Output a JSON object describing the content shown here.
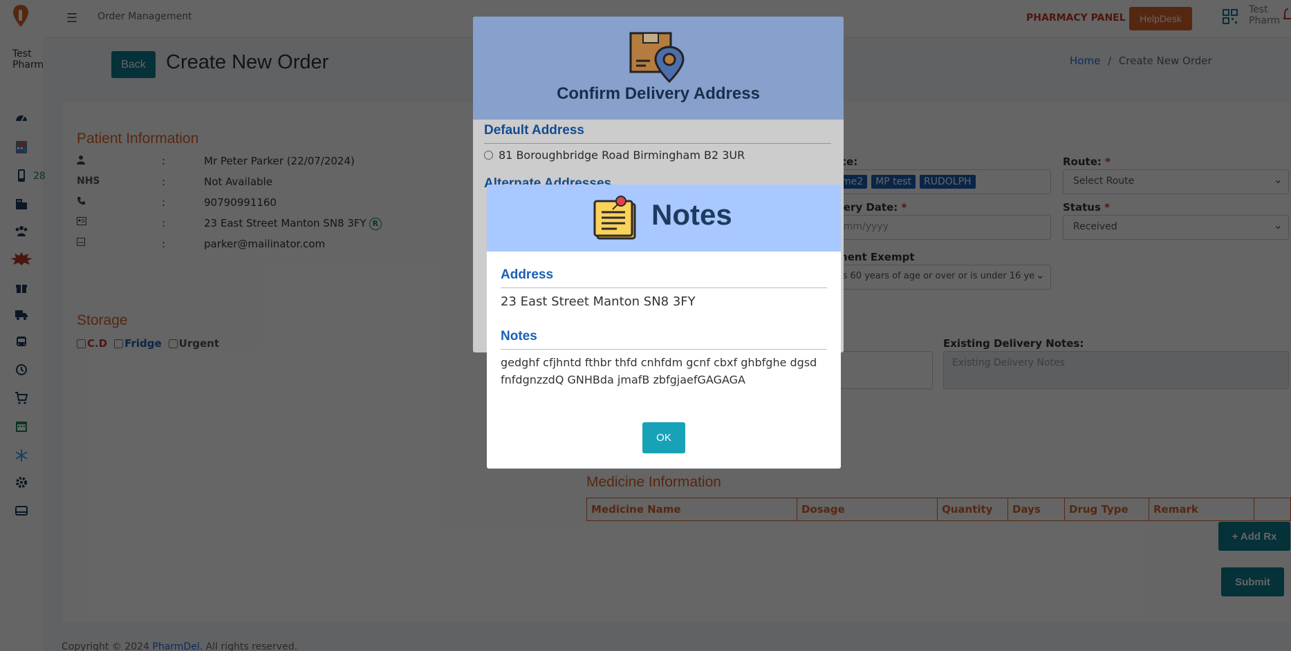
{
  "topbar": {
    "title": "Order Management",
    "panel_label": "PHARMACY PANEL",
    "helpdesk_label": "HelpDesk",
    "user_alt": "Test Pharm"
  },
  "sidebar": {
    "avatar_alt": "Test Pharm",
    "badge_count": "28",
    "icons": [
      "dashboard-icon",
      "calculator-icon",
      "mobile-icon",
      "building-icon",
      "users-icon",
      "promo-icon",
      "gift-icon",
      "truck-icon",
      "bus-icon",
      "history-icon",
      "cart-icon",
      "calendar-icon",
      "snowflake-icon",
      "gear-icon",
      "card-icon"
    ]
  },
  "page": {
    "back_label": "Back",
    "title": "Create New Order",
    "breadcrumb_home": "Home",
    "breadcrumb_sep": "/",
    "breadcrumb_current": "Create New Order"
  },
  "patient": {
    "section_title": "Patient Information",
    "colon": ":",
    "nhs_label": "NHS",
    "name": "Mr Peter Parker (22/07/2024)",
    "nhs": "Not Available",
    "phone": "90790991160",
    "address": "23 East Street Manton SN8 3FY",
    "address_badge": "R",
    "email": "parker@mailinator.com"
  },
  "storage": {
    "section_title": "Storage",
    "cd_label": "C.D",
    "fridge_label": "Fridge",
    "urgent_label": "Urgent"
  },
  "form": {
    "service_label": "ice:",
    "service_tags": [
      "me2",
      "MP test",
      "RUDOLPH"
    ],
    "route_label": "Route:",
    "route_placeholder": "Select Route",
    "delivery_date_label": "very Date:",
    "delivery_date_placeholder": "/mm/yyyy",
    "status_label": "Status",
    "status_value": "Received",
    "exempt_label": "ment Exempt",
    "exempt_value": "is 60 years of age or over or is under 16 ye",
    "existing_notes_label": "Existing Delivery Notes:",
    "existing_notes_placeholder": "Existing Delivery Notes",
    "required_mark": "*"
  },
  "medicine": {
    "section_title": "Medicine Information",
    "columns": [
      "Medicine Name",
      "Dosage",
      "Quantity",
      "Days",
      "Drug Type",
      "Remark",
      ""
    ],
    "add_rx_label": "+ Add Rx",
    "submit_label": "Submit"
  },
  "footer": {
    "text_before": "Copyright © 2024 ",
    "brand": "PharmDel",
    "text_after": ". All rights reserved."
  },
  "confirm_modal": {
    "title": "Confirm Delivery Address",
    "default_heading": "Default Address",
    "default_address": "81 Boroughbridge Road Birmingham B2 3UR",
    "alternate_heading": "Alternate Addresses"
  },
  "notes_modal": {
    "title": "Notes",
    "address_heading": "Address",
    "address": "23 East Street Manton SN8 3FY",
    "notes_heading": "Notes",
    "notes_text": "gedghf cfjhntd fthbr thfd cnhfdm gcnf cbxf ghbfghe dgsd fnfdgnzzdQ GNHBda jmafB zbfgjaefGAGAGA",
    "ok_label": "OK"
  },
  "colors": {
    "accent_orange": "#d9622b",
    "teal": "#0e7d8d",
    "modal_header": "#a9c8ff",
    "heading_blue": "#1a5fb4"
  }
}
